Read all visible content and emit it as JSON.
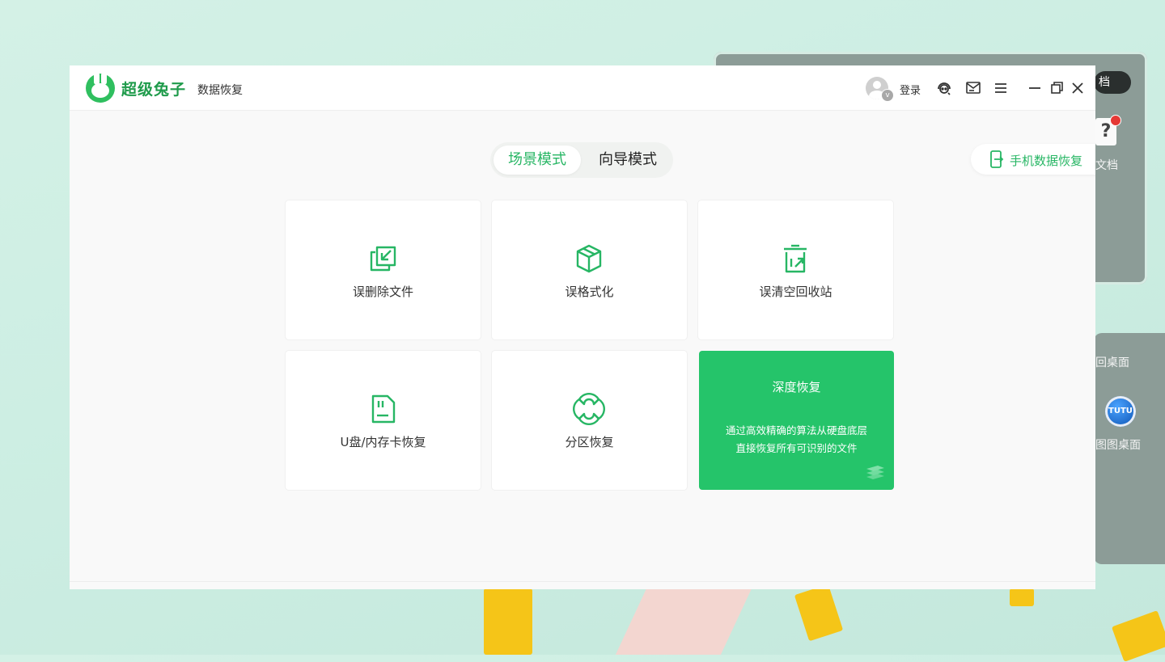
{
  "desktop": {
    "pill_label": "档",
    "help_label": "?",
    "doc_label": "文档",
    "back_label": "回桌面",
    "tutu_icon_text": "TUTU",
    "tutu_label": "图图桌面"
  },
  "app": {
    "brand_name": "超级兔子",
    "brand_sub": "数据恢复",
    "login_label": "登录",
    "vip_badge": "v",
    "mode_tabs": [
      {
        "label": "场景模式",
        "active": true
      },
      {
        "label": "向导模式",
        "active": false
      }
    ],
    "phone_recovery_label": "手机数据恢复",
    "cards": [
      {
        "label": "误删除文件",
        "icon": "file-restore-icon"
      },
      {
        "label": "误格式化",
        "icon": "cube-icon"
      },
      {
        "label": "误清空回收站",
        "icon": "trash-restore-icon"
      },
      {
        "label": "U盘/内存卡恢复",
        "icon": "sd-card-icon"
      },
      {
        "label": "分区恢复",
        "icon": "partition-icon"
      }
    ],
    "deep_card": {
      "title": "深度恢复",
      "desc_line1": "通过高效精确的算法从硬盘底层",
      "desc_line2": "直接恢复所有可识别的文件"
    },
    "colors": {
      "accent": "#27b664",
      "deep_card_bg": "#25c46a",
      "brand": "#1f9b4b"
    }
  }
}
